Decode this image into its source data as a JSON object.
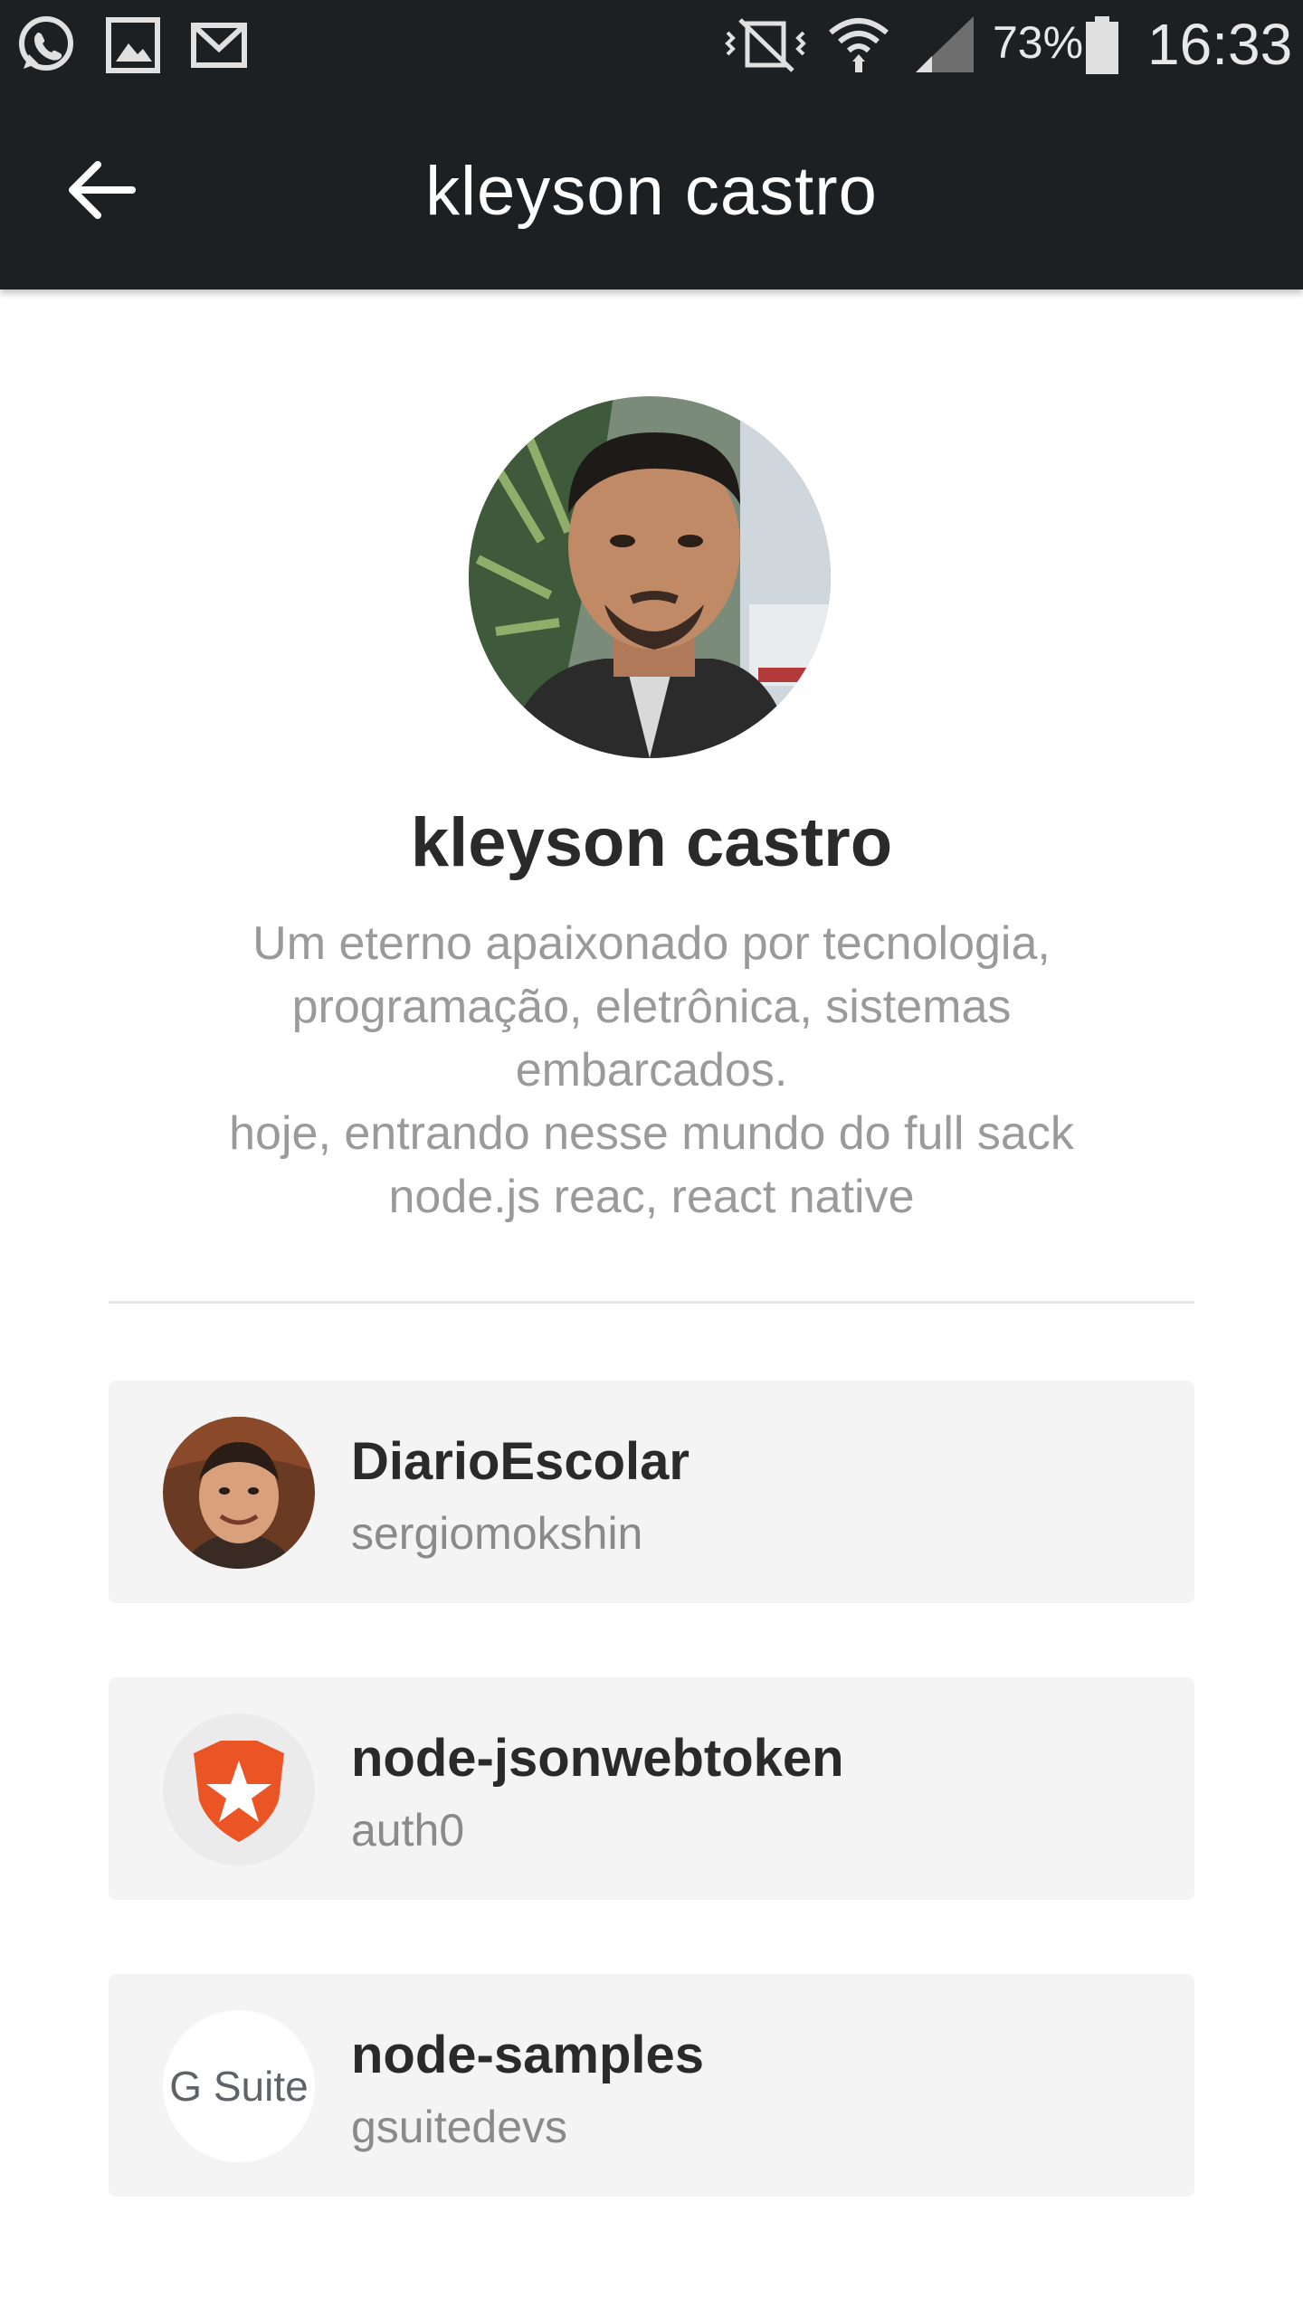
{
  "status_bar": {
    "battery_percent": "73%",
    "time": "16:33",
    "icons": [
      "whatsapp-icon",
      "gallery-icon",
      "gmail-icon",
      "vibrate-icon",
      "wifi-icon",
      "signal-icon",
      "battery-icon"
    ]
  },
  "app_bar": {
    "title": "kleyson castro",
    "back_icon": "arrow-left-icon"
  },
  "profile": {
    "name": "kleyson castro",
    "bio": "Um eterno apaixonado por tecnologia,\nprogramação, eletrônica, sistemas\nembarcados.\nhoje, entrando nesse mundo do full sack\nnode.js reac, react native"
  },
  "repos": [
    {
      "name": "DiarioEscolar",
      "owner": "sergiomokshin",
      "avatar": "person-photo"
    },
    {
      "name": "node-jsonwebtoken",
      "owner": "auth0",
      "avatar": "auth0-logo"
    },
    {
      "name": "node-samples",
      "owner": "gsuitedevs",
      "avatar": "gsuite-logo",
      "avatar_text": "G Suite"
    }
  ],
  "colors": {
    "bar_background": "#1c2023",
    "card_background": "#f4f4f4",
    "auth0_orange": "#eb5424"
  }
}
